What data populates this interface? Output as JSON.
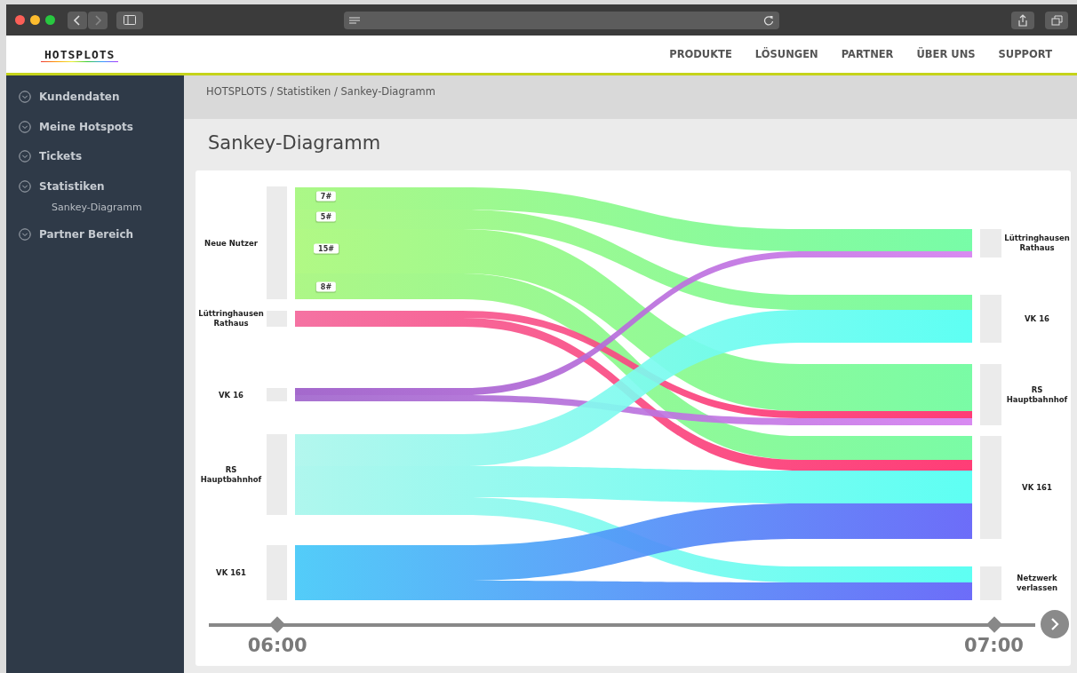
{
  "header": {
    "logo": "HOTSPLOTS",
    "nav": [
      {
        "label": "PRODUKTE"
      },
      {
        "label": "LÖSUNGEN"
      },
      {
        "label": "PARTNER"
      },
      {
        "label": "ÜBER UNS"
      },
      {
        "label": "SUPPORT"
      }
    ]
  },
  "sidebar": {
    "items": [
      {
        "label": "Kundendaten"
      },
      {
        "label": "Meine Hotspots"
      },
      {
        "label": "Tickets"
      },
      {
        "label": "Statistiken",
        "children": [
          {
            "label": "Sankey-Diagramm"
          }
        ]
      },
      {
        "label": "Partner Bereich"
      }
    ]
  },
  "breadcrumb": "HOTSPLOTS / Statistiken / Sankey-Diagramm",
  "page_title": "Sankey-Diagramm",
  "sankey": {
    "sources": [
      "Neue Nutzer",
      "Lüttringhausen Rathaus",
      "VK 16",
      "RS Hauptbahnhof",
      "VK 161"
    ],
    "targets": [
      "Lüttringhausen Rathaus",
      "VK 16",
      "RS Hauptbahnhof",
      "VK 161",
      "Netzwerk verlassen"
    ],
    "flow_labels": [
      "7#",
      "5#",
      "15#",
      "8#"
    ]
  },
  "timeline": {
    "start": {
      "label": "06:00",
      "level": 0.083
    },
    "end": {
      "label": "07:00",
      "level": 0.95
    }
  }
}
